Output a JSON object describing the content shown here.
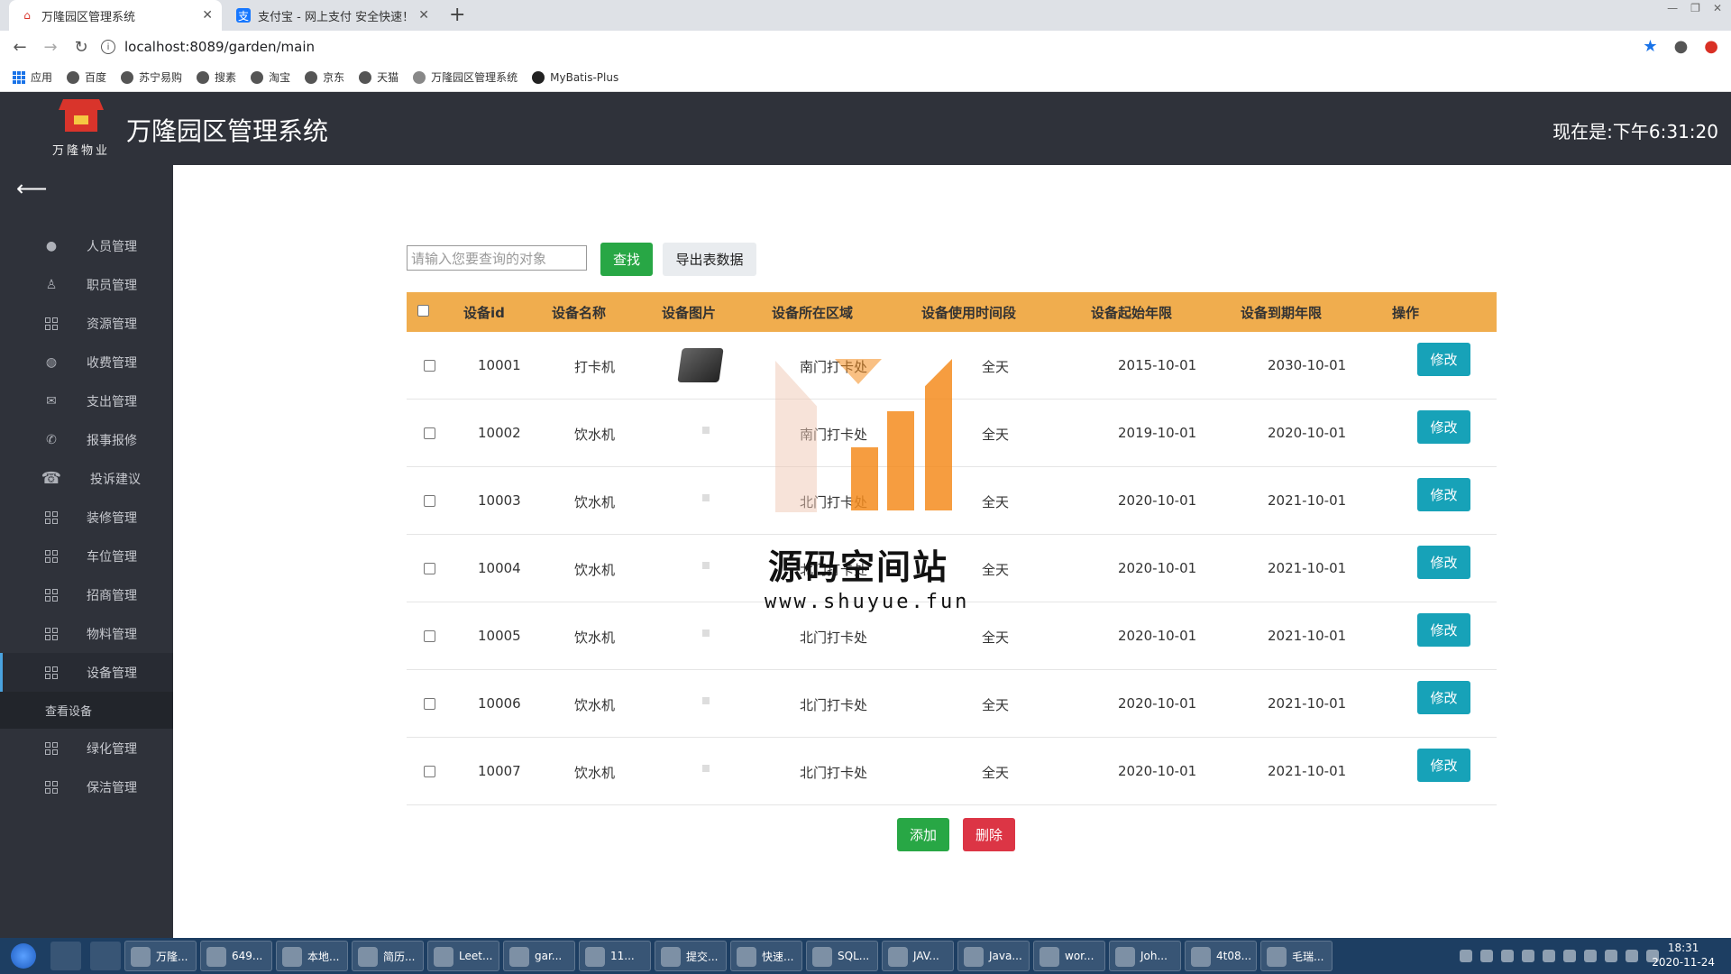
{
  "browser": {
    "tabs": [
      {
        "title": "万隆园区管理系统",
        "favicon": "garden-icon"
      },
      {
        "title": "支付宝 - 网上支付 安全快速！",
        "favicon": "alipay-icon"
      }
    ],
    "new_tab": "+",
    "url": "localhost:8089/garden/main",
    "bookmarks": [
      "应用",
      "百度",
      "苏宁易购",
      "搜素",
      "淘宝",
      "京东",
      "天猫",
      "万隆园区管理系统",
      "MyBatis-Plus"
    ]
  },
  "header": {
    "logo_text": "万隆物业",
    "title": "万隆园区管理系统",
    "clock": "现在是:下午6:31:20"
  },
  "sidebar": {
    "items": [
      {
        "label": "人员管理",
        "icon": "person-icon"
      },
      {
        "label": "职员管理",
        "icon": "staff-icon"
      },
      {
        "label": "资源管理",
        "icon": "grid-icon"
      },
      {
        "label": "收费管理",
        "icon": "globe-icon"
      },
      {
        "label": "支出管理",
        "icon": "mail-icon"
      },
      {
        "label": "报事报修",
        "icon": "phone-icon"
      },
      {
        "label": "投诉建议",
        "icon": "telephone-icon"
      },
      {
        "label": "装修管理",
        "icon": "grid-icon"
      },
      {
        "label": "车位管理",
        "icon": "grid-icon"
      },
      {
        "label": "招商管理",
        "icon": "grid-icon"
      },
      {
        "label": "物料管理",
        "icon": "grid-icon"
      },
      {
        "label": "设备管理",
        "icon": "grid-icon"
      },
      {
        "label": "绿化管理",
        "icon": "grid-icon"
      },
      {
        "label": "保洁管理",
        "icon": "grid-icon"
      }
    ],
    "active_submenu": "查看设备"
  },
  "toolbar": {
    "search_placeholder": "请输入您要查询的对象",
    "search_label": "查找",
    "export_label": "导出表数据"
  },
  "table": {
    "headers": [
      "设备id",
      "设备名称",
      "设备图片",
      "设备所在区域",
      "设备使用时间段",
      "设备起始年限",
      "设备到期年限",
      "操作"
    ],
    "rows": [
      {
        "id": "10001",
        "name": "打卡机",
        "image": "time-clock",
        "area": "南门打卡处",
        "period": "全天",
        "start": "2015-10-01",
        "end": "2030-10-01"
      },
      {
        "id": "10002",
        "name": "饮水机",
        "image": "water-dispenser",
        "area": "南门打卡处",
        "period": "全天",
        "start": "2019-10-01",
        "end": "2020-10-01"
      },
      {
        "id": "10003",
        "name": "饮水机",
        "image": "water-dispenser",
        "area": "北门打卡处",
        "period": "全天",
        "start": "2020-10-01",
        "end": "2021-10-01"
      },
      {
        "id": "10004",
        "name": "饮水机",
        "image": "water-dispenser",
        "area": "北门打卡处",
        "period": "全天",
        "start": "2020-10-01",
        "end": "2021-10-01"
      },
      {
        "id": "10005",
        "name": "饮水机",
        "image": "water-dispenser",
        "area": "北门打卡处",
        "period": "全天",
        "start": "2020-10-01",
        "end": "2021-10-01"
      },
      {
        "id": "10006",
        "name": "饮水机",
        "image": "water-dispenser",
        "area": "北门打卡处",
        "period": "全天",
        "start": "2020-10-01",
        "end": "2021-10-01"
      },
      {
        "id": "10007",
        "name": "饮水机",
        "image": "water-dispenser",
        "area": "北门打卡处",
        "period": "全天",
        "start": "2020-10-01",
        "end": "2021-10-01"
      }
    ],
    "edit_label": "修改"
  },
  "actions": {
    "add_label": "添加",
    "delete_label": "删除"
  },
  "watermark": {
    "title": "源码空间站",
    "url": "www.shuyue.fun"
  },
  "taskbar": {
    "tasks": [
      "万隆...",
      "649...",
      "本地...",
      "简历...",
      "Leet...",
      "gar...",
      "11...",
      "提交...",
      "快速...",
      "SQL...",
      "JAV...",
      "Java...",
      "wor...",
      "Joh...",
      "4t08...",
      "毛瑞..."
    ],
    "time": "18:31",
    "date": "2020-11-24"
  },
  "colors": {
    "header_bg": "#2f323a",
    "table_header": "#f0ad4e",
    "search_btn": "#28a745",
    "edit_btn": "#17a2b8",
    "delete_btn": "#dc3545"
  }
}
